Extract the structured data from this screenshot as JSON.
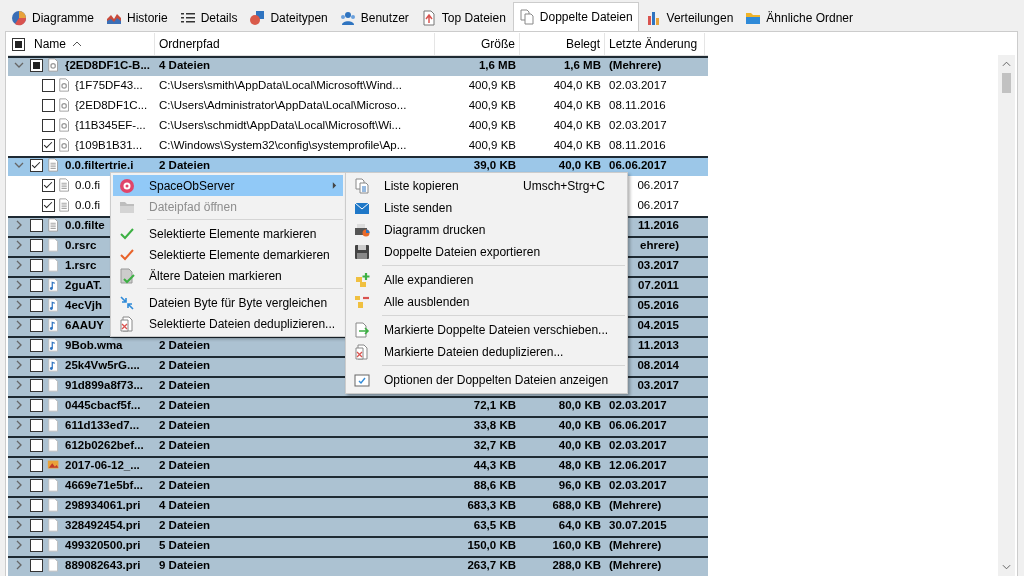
{
  "tabs": [
    {
      "label": "Diagramme",
      "selected": false
    },
    {
      "label": "Historie",
      "selected": false
    },
    {
      "label": "Details",
      "selected": false
    },
    {
      "label": "Dateitypen",
      "selected": false
    },
    {
      "label": "Benutzer",
      "selected": false
    },
    {
      "label": "Top Dateien",
      "selected": false
    },
    {
      "label": "Doppelte Dateien",
      "selected": true
    },
    {
      "label": "Verteilungen",
      "selected": false
    },
    {
      "label": "Ähnliche Ordner",
      "selected": false
    }
  ],
  "table": {
    "header_checkbox": {
      "checked": false,
      "mixed": true
    },
    "columns": [
      {
        "label": "Name",
        "sorted": true
      },
      {
        "label": "Ordnerpfad",
        "sorted": false
      },
      {
        "label": "Größe",
        "sorted": false
      },
      {
        "label": "Belegt",
        "sorted": false
      },
      {
        "label": "Letzte Änderung",
        "sorted": false
      }
    ],
    "rows": [
      {
        "name": "{2ED8DF1C-B...",
        "path": "4 Dateien",
        "size": "1,6 MB",
        "allocated": "1,6 MB",
        "date": "(Mehrere)",
        "kind": "system",
        "expanded": true,
        "checked": false,
        "mixed": true,
        "selected": false,
        "covered": false,
        "children": [
          {
            "name": "{1F75DF43...",
            "path": "C:\\Users\\smith\\AppData\\Local\\Microsoft\\Wind...",
            "size": "400,9 KB",
            "allocated": "404,0 KB",
            "date": "02.03.2017",
            "kind": "system",
            "checked": false,
            "selected": false,
            "covered": false
          },
          {
            "name": "{2ED8DF1C...",
            "path": "C:\\Users\\Administrator\\AppData\\Local\\Microso...",
            "size": "400,9 KB",
            "allocated": "404,0 KB",
            "date": "08.11.2016",
            "kind": "system",
            "checked": false,
            "selected": false,
            "covered": false
          },
          {
            "name": "{11B345EF-...",
            "path": "C:\\Users\\schmidt\\AppData\\Local\\Microsoft\\Wi...",
            "size": "400,9 KB",
            "allocated": "404,0 KB",
            "date": "02.03.2017",
            "kind": "system",
            "checked": false,
            "selected": false,
            "covered": false
          },
          {
            "name": "{109B1B31...",
            "path": "C:\\Windows\\System32\\config\\systemprofile\\Ap...",
            "size": "400,9 KB",
            "allocated": "404,0 KB",
            "date": "08.11.2016",
            "kind": "system",
            "checked": true,
            "selected": false,
            "covered": false
          }
        ]
      },
      {
        "name": "0.0.filtertrie.i",
        "path": "2 Dateien",
        "size": "39,0 KB",
        "allocated": "40,0 KB",
        "date": "06.06.2017",
        "kind": "text",
        "expanded": true,
        "checked": true,
        "mixed": false,
        "selected": true,
        "covered": false,
        "children": [
          {
            "name": "0.0.fi",
            "date": "06.2017",
            "kind": "text",
            "checked": true,
            "selected": false,
            "covered": true
          },
          {
            "name": "0.0.fi",
            "date": "06.2017",
            "kind": "text",
            "checked": true,
            "selected": false,
            "covered": true
          }
        ]
      },
      {
        "name": "0.0.filte",
        "date": "11.2016",
        "kind": "text",
        "expanded": false,
        "checked": false,
        "mixed": false,
        "selected": false,
        "covered": true
      },
      {
        "name": "0.rsrc",
        "date": "ehrere)",
        "kind": "blank",
        "expanded": false,
        "checked": false,
        "mixed": false,
        "selected": false,
        "covered": true
      },
      {
        "name": "1.rsrc",
        "date": "03.2017",
        "kind": "blank",
        "expanded": false,
        "checked": false,
        "mixed": false,
        "selected": false,
        "covered": true
      },
      {
        "name": "2guAT.",
        "date": "07.2011",
        "kind": "audio",
        "expanded": false,
        "checked": false,
        "mixed": false,
        "selected": false,
        "covered": true
      },
      {
        "name": "4ecVjh",
        "date": "05.2016",
        "kind": "audio",
        "expanded": false,
        "checked": false,
        "mixed": false,
        "selected": false,
        "covered": true
      },
      {
        "name": "6AAUY",
        "date": "04.2015",
        "kind": "audio",
        "expanded": false,
        "checked": false,
        "mixed": false,
        "selected": false,
        "covered": true
      },
      {
        "name": "9Bob.wma",
        "path": "2 Dateien",
        "date": "11.2013",
        "kind": "audio",
        "expanded": false,
        "checked": false,
        "mixed": false,
        "selected": false,
        "covered": true
      },
      {
        "name": "25k4Vw5rG....",
        "path": "2 Dateien",
        "date": "08.2014",
        "kind": "audio",
        "expanded": false,
        "checked": false,
        "mixed": false,
        "selected": false,
        "covered": true
      },
      {
        "name": "91d899a8f73...",
        "path": "2 Dateien",
        "date": "03.2017",
        "kind": "blank",
        "expanded": false,
        "checked": false,
        "mixed": false,
        "selected": false,
        "covered": true
      },
      {
        "name": "0445cbacf5f...",
        "path": "2 Dateien",
        "size": "72,1 KB",
        "allocated": "80,0 KB",
        "date": "02.03.2017",
        "kind": "blank",
        "expanded": false,
        "checked": false,
        "mixed": false,
        "selected": false,
        "covered": false
      },
      {
        "name": "611d133ed7...",
        "path": "2 Dateien",
        "size": "33,8 KB",
        "allocated": "40,0 KB",
        "date": "06.06.2017",
        "kind": "blank",
        "expanded": false,
        "checked": false,
        "mixed": false,
        "selected": false,
        "covered": false
      },
      {
        "name": "612b0262bef...",
        "path": "2 Dateien",
        "size": "32,7 KB",
        "allocated": "40,0 KB",
        "date": "02.03.2017",
        "kind": "blank",
        "expanded": false,
        "checked": false,
        "mixed": false,
        "selected": false,
        "covered": false
      },
      {
        "name": "2017-06-12_...",
        "path": "2 Dateien",
        "size": "44,3 KB",
        "allocated": "48,0 KB",
        "date": "12.06.2017",
        "kind": "image",
        "expanded": false,
        "checked": false,
        "mixed": false,
        "selected": false,
        "covered": false
      },
      {
        "name": "4669e71e5bf...",
        "path": "2 Dateien",
        "size": "88,6 KB",
        "allocated": "96,0 KB",
        "date": "02.03.2017",
        "kind": "blank",
        "expanded": false,
        "checked": false,
        "mixed": false,
        "selected": false,
        "covered": false
      },
      {
        "name": "298934061.pri",
        "path": "4 Dateien",
        "size": "683,3 KB",
        "allocated": "688,0 KB",
        "date": "(Mehrere)",
        "kind": "blank",
        "expanded": false,
        "checked": false,
        "mixed": false,
        "selected": false,
        "covered": false
      },
      {
        "name": "328492454.pri",
        "path": "2 Dateien",
        "size": "63,5 KB",
        "allocated": "64,0 KB",
        "date": "30.07.2015",
        "kind": "blank",
        "expanded": false,
        "checked": false,
        "mixed": false,
        "selected": false,
        "covered": false
      },
      {
        "name": "499320500.pri",
        "path": "5 Dateien",
        "size": "150,0 KB",
        "allocated": "160,0 KB",
        "date": "(Mehrere)",
        "kind": "blank",
        "expanded": false,
        "checked": false,
        "mixed": false,
        "selected": false,
        "covered": false
      },
      {
        "name": "889082643.pri",
        "path": "9 Dateien",
        "size": "263,7 KB",
        "allocated": "288,0 KB",
        "date": "(Mehrere)",
        "kind": "blank",
        "expanded": false,
        "checked": false,
        "mixed": false,
        "selected": false,
        "covered": false
      }
    ]
  },
  "context_menu": {
    "items": [
      {
        "kind": "item",
        "label": "SpaceObServer",
        "selected": true,
        "disabled": false,
        "submenu": true
      },
      {
        "kind": "item",
        "label": "Dateipfad öffnen",
        "selected": false,
        "disabled": true,
        "submenu": false
      },
      {
        "kind": "separator"
      },
      {
        "kind": "item",
        "label": "Selektierte Elemente markieren",
        "selected": false,
        "disabled": false,
        "submenu": false
      },
      {
        "kind": "item",
        "label": "Selektierte Elemente demarkieren",
        "selected": false,
        "disabled": false,
        "submenu": false
      },
      {
        "kind": "item",
        "label": "Ältere Dateien markieren",
        "selected": false,
        "disabled": false,
        "submenu": false
      },
      {
        "kind": "separator"
      },
      {
        "kind": "item",
        "label": "Dateien Byte für Byte vergleichen",
        "selected": false,
        "disabled": false,
        "submenu": false
      },
      {
        "kind": "item",
        "label": "Selektierte Dateien deduplizieren...",
        "selected": false,
        "disabled": false,
        "submenu": false
      }
    ]
  },
  "submenu": {
    "items": [
      {
        "kind": "item",
        "label": "Liste kopieren",
        "shortcut": "Umsch+Strg+C"
      },
      {
        "kind": "item",
        "label": "Liste senden"
      },
      {
        "kind": "item",
        "label": "Diagramm drucken"
      },
      {
        "kind": "item",
        "label": "Doppelte Dateien exportieren"
      },
      {
        "kind": "separator"
      },
      {
        "kind": "item",
        "label": "Alle expandieren"
      },
      {
        "kind": "item",
        "label": "Alle ausblenden"
      },
      {
        "kind": "separator"
      },
      {
        "kind": "item",
        "label": "Markierte Doppelte Dateien verschieben..."
      },
      {
        "kind": "item",
        "label": "Markierte Dateien deduplizieren..."
      },
      {
        "kind": "separator"
      },
      {
        "kind": "item",
        "label": "Optionen der Doppelten Dateien anzeigen"
      }
    ]
  }
}
